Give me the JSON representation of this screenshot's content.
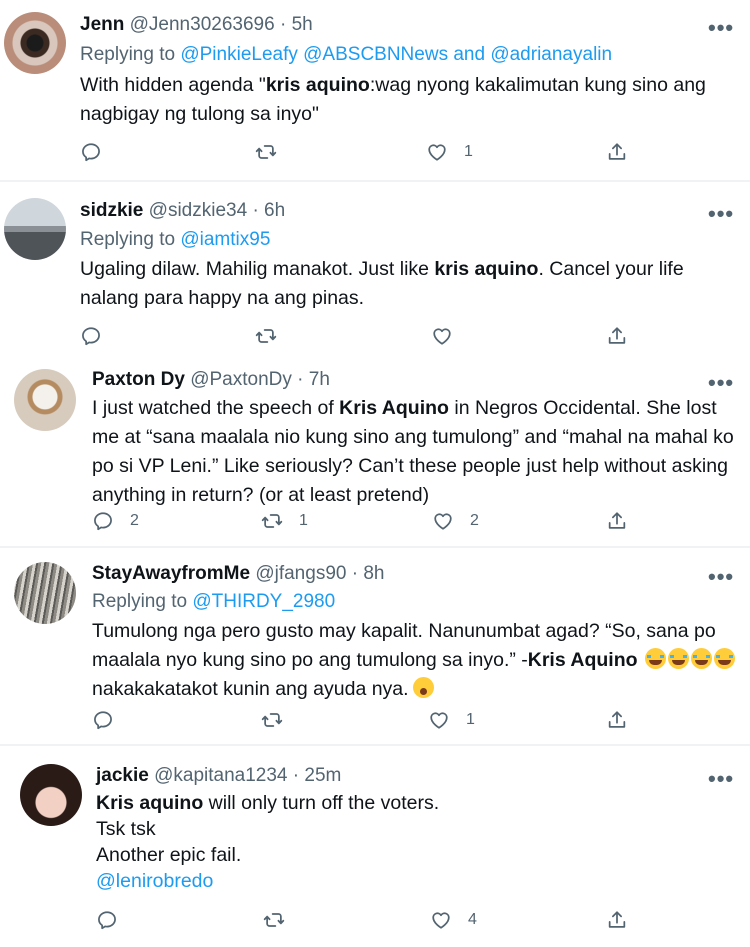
{
  "tweets": [
    {
      "name": "Jenn",
      "handle": "@Jenn30263696",
      "time": "5h",
      "reply_prefix": "Replying to ",
      "reply_to": "@PinkieLeafy @ABSCBNNews and @adrianayalin",
      "text_1": "With hidden agenda \"",
      "bold_1": "kris aquino",
      "text_2": ":wag nyong kakalimutan kung sino ang nagbigay ng tulong sa inyo\"",
      "replies": "",
      "retweets": "",
      "likes": "1"
    },
    {
      "name": "sidzkie",
      "handle": "@sidzkie34",
      "time": "6h",
      "reply_prefix": "Replying to ",
      "reply_to": "@iamtix95",
      "text_1": "Ugaling dilaw. Mahilig manakot. Just like ",
      "bold_1": "kris aquino",
      "text_2": ". Cancel your life nalang para happy na ang pinas.",
      "replies": "",
      "retweets": "",
      "likes": ""
    },
    {
      "name": "Paxton Dy",
      "handle": "@PaxtonDy",
      "time": "7h",
      "text_1": "I just watched the speech of ",
      "bold_1": "Kris Aquino",
      "text_2": " in Negros Occidental. She lost me at “sana maalala nio kung sino ang tumulong” and “mahal na mahal ko po si VP Leni.” Like seriously? Can’t these people just help without asking anything in return? (or at least pretend)",
      "replies": "2",
      "retweets": "1",
      "likes": "2"
    },
    {
      "name": "StayAwayfromMe",
      "handle": "@jfangs90",
      "time": "8h",
      "reply_prefix": "Replying to ",
      "reply_to": "@THIRDY_2980",
      "text_1": "Tumulong nga pero gusto may kapalit. Nanunumbat agad? “So, sana po maalala nyo kung sino po ang tumulong sa inyo.” -",
      "bold_1": "Kris Aquino",
      "text_2": "nakakakatakot kunin ang ayuda nya.",
      "replies": "",
      "retweets": "",
      "likes": "1"
    },
    {
      "name": "jackie",
      "handle": "@kapitana1234",
      "time": "25m",
      "bold_1": "Kris aquino",
      "text_1": " will only turn off the voters.",
      "line_2": "Tsk tsk",
      "line_3": "Another epic fail.",
      "mention": "@lenirobredo",
      "replies": "",
      "retweets": "",
      "likes": "4"
    }
  ],
  "icons": {
    "reply": "reply-icon",
    "retweet": "retweet-icon",
    "like": "heart-icon",
    "share": "share-icon",
    "more": "more-icon",
    "emoji_laugh": "tears-of-joy-emoji",
    "emoji_shock": "hushed-face-emoji"
  },
  "more_glyph": "•••",
  "colors": {
    "link": "#1d9bf0",
    "secondary": "#536471",
    "text": "#0f1419"
  }
}
